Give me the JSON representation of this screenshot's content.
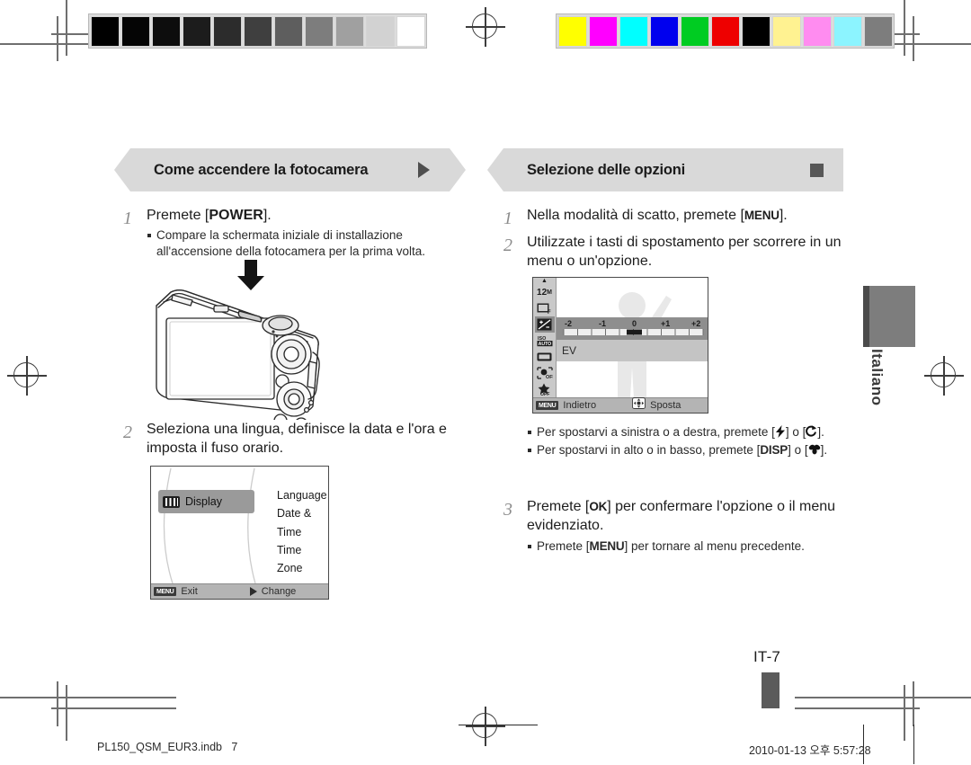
{
  "document": {
    "page_label": "IT-7",
    "language_tab": "Italiano"
  },
  "color_bars": {
    "grayscale": [
      "#000000",
      "#050505",
      "#0d0d0d",
      "#1c1c1c",
      "#2c2c2c",
      "#3f3f3f",
      "#5e5e5e",
      "#7d7d7d",
      "#a0a0a0",
      "#d2d2d2",
      "#ffffff"
    ],
    "color": [
      "#ffff00",
      "#ff00ff",
      "#00ffff",
      "#0000ee",
      "#00cc22",
      "#ee0000",
      "#000000",
      "#fff291",
      "#ff8cf0",
      "#8cf4ff",
      "#7d7d7d"
    ]
  },
  "left_column": {
    "header": {
      "title": "Come accendere la fotocamera",
      "mark": "triangle-right"
    },
    "steps": [
      {
        "number": "1",
        "lead_pre": "Premete [",
        "lead_key": "POWER",
        "lead_post": "].",
        "bullets": [
          "Compare la schermata iniziale di installazione all'accensione della fotocamera per la prima volta."
        ]
      },
      {
        "number": "2",
        "lead_plain": "Seleziona una lingua, definisce la data e l'ora e imposta il fuso orario.",
        "bullets": []
      }
    ],
    "camera_illustration": {
      "alt": "camera-rear-view-line-art",
      "arrow": "down-arrow-to-power-button"
    },
    "settings_screen": {
      "selected_item": "Display",
      "selected_icon": "display-icon",
      "menu_items": [
        "Language",
        "Date & Time",
        "Time Zone"
      ],
      "footer_left_chip": "MENU",
      "footer_left_label": "Exit",
      "footer_right_icon": "play-right-icon",
      "footer_right_label": "Change"
    }
  },
  "right_column": {
    "header": {
      "title": "Selezione delle opzioni",
      "mark": "square"
    },
    "steps": [
      {
        "number": "1",
        "lead_pre": "Nella modalità di scatto, premete [",
        "lead_key": "MENU",
        "lead_post": "].",
        "bullets": []
      },
      {
        "number": "2",
        "lead_plain": "Utilizzate i tasti di spostamento per scorrere in un menu o un'opzione.",
        "bullets": []
      },
      {
        "number": "3",
        "lead_pre": "Premete [",
        "lead_key": "OK",
        "lead_post": "] per confermare l'opzione o il menu evidenziato.",
        "bullets": [
          {
            "pre": "Premete [",
            "key": "MENU",
            "post": "] per tornare al menu precedente."
          }
        ]
      }
    ],
    "ev_screen": {
      "sidebar_icons": [
        "resolution-12m-icon",
        "quality-fine-icon",
        "ev-exposure-icon",
        "iso-auto-icon",
        "white-balance-icon",
        "face-detection-off-icon",
        "smart-filter-off-icon"
      ],
      "selected_sidebar_index": 2,
      "scale_labels": [
        "-2",
        "-1",
        "0",
        "+1",
        "+2"
      ],
      "option_label": "EV",
      "footer_left_chip": "MENU",
      "footer_left_label": "Indietro",
      "footer_right_icon": "dpad-icon",
      "footer_right_label": "Sposta"
    },
    "nav_bullets": [
      {
        "pre": "Per spostarvi a sinistra o a destra, premete [",
        "icon1": "flash-icon",
        "mid": "] o [",
        "icon2": "timer-icon",
        "post": "]."
      },
      {
        "pre": "Per spostarvi in alto o in basso, premete [",
        "key": "DISP",
        "mid": "] o [",
        "icon2": "macro-flower-icon",
        "post": "]."
      }
    ]
  },
  "footer": {
    "file_name": "PL150_QSM_EUR3.indb",
    "page_number": "7",
    "timestamp": "2010-01-13   오후 5:57:28"
  }
}
